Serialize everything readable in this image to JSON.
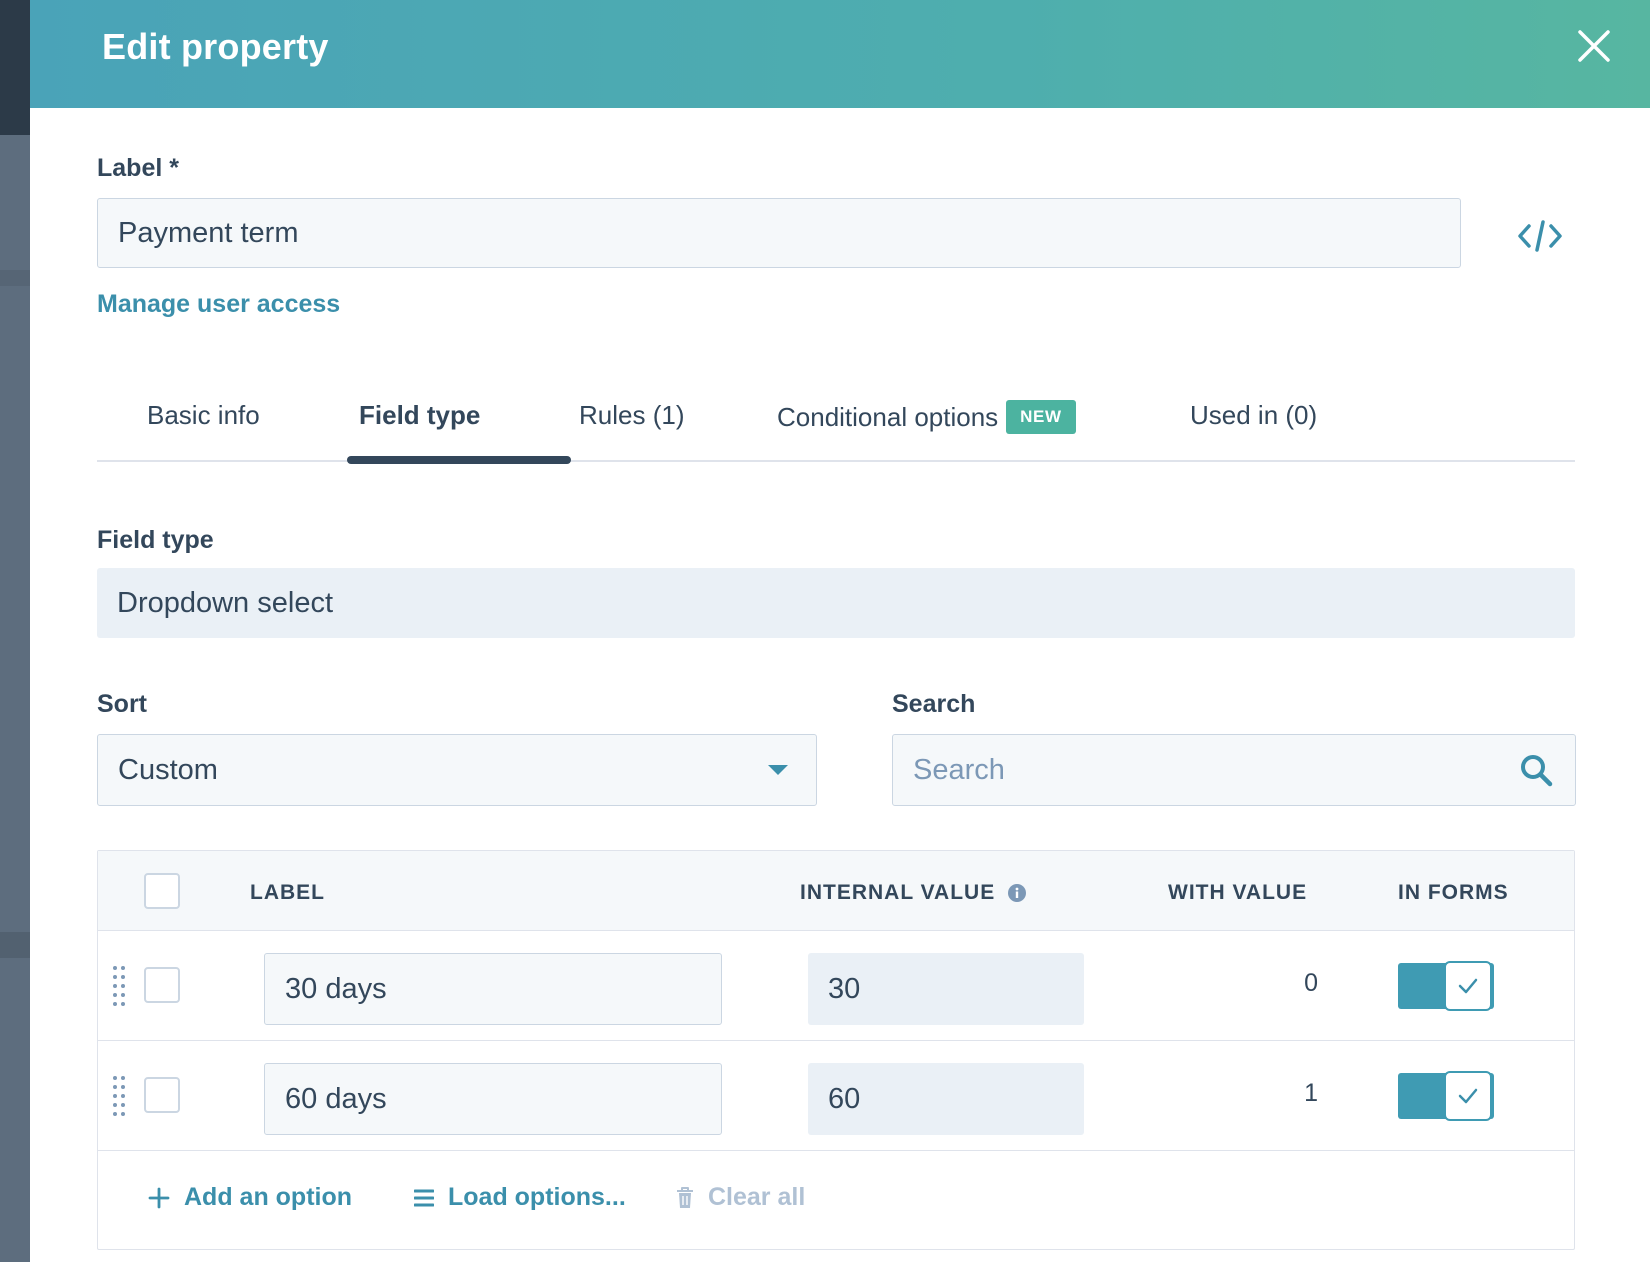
{
  "modal": {
    "title": "Edit property",
    "close_icon": "close-icon"
  },
  "label_field": {
    "label": "Label *",
    "value": "Payment term",
    "code_icon": "code-icon"
  },
  "manage_access_link": "Manage user access",
  "tabs": [
    {
      "label": "Basic info",
      "active": false
    },
    {
      "label": "Field type",
      "active": true
    },
    {
      "label": "Rules (1)",
      "active": false
    },
    {
      "label": "Conditional options",
      "badge": "NEW",
      "active": false
    },
    {
      "label": "Used in (0)",
      "active": false
    }
  ],
  "field_type": {
    "label": "Field type",
    "value": "Dropdown select"
  },
  "sort": {
    "label": "Sort",
    "value": "Custom"
  },
  "search": {
    "label": "Search",
    "placeholder": "Search"
  },
  "table": {
    "headers": {
      "label": "LABEL",
      "internal_value": "INTERNAL VALUE",
      "with_value": "WITH VALUE",
      "in_forms": "IN FORMS"
    },
    "rows": [
      {
        "label": "30 days",
        "internal_value": "30",
        "with_value": "0",
        "in_forms": true
      },
      {
        "label": "60 days",
        "internal_value": "60",
        "with_value": "1",
        "in_forms": true
      }
    ]
  },
  "actions": {
    "add_option": "Add an option",
    "load_options": "Load options...",
    "clear_all": "Clear all"
  },
  "colors": {
    "accent": "#3b8fab",
    "header_gradient_start": "#4aa3b8",
    "header_gradient_end": "#57b6a1",
    "badge": "#4cb3a0",
    "text": "#33475b"
  }
}
